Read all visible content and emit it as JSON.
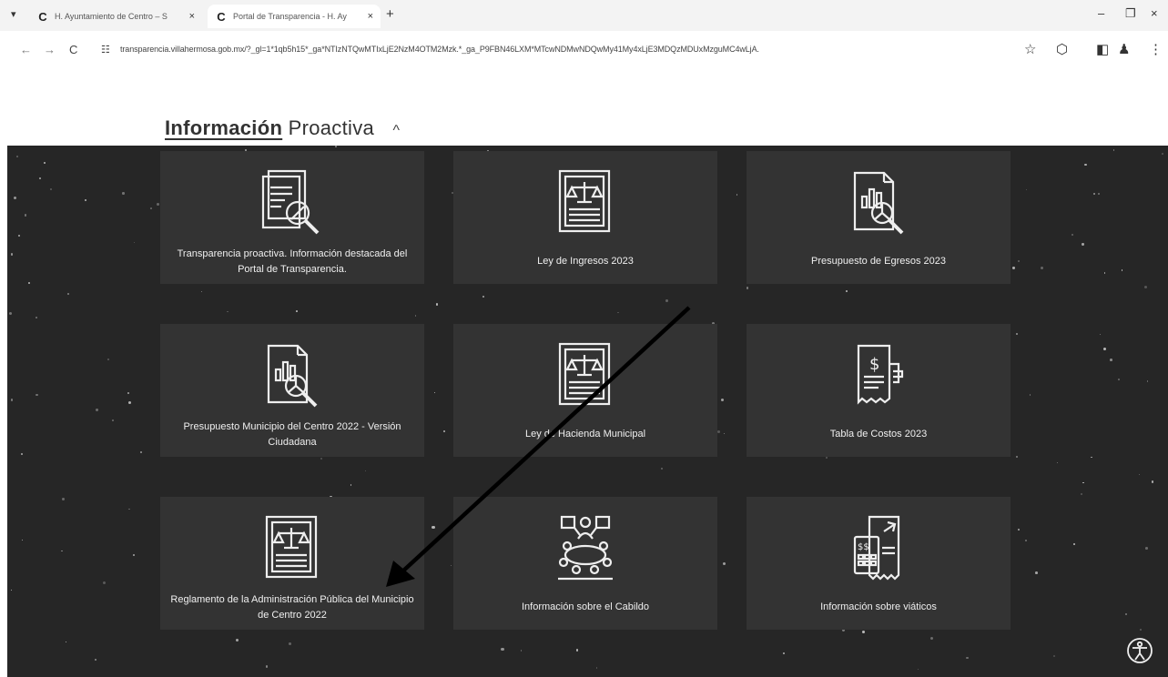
{
  "browser": {
    "tabs": [
      {
        "favicon": "C",
        "title": "H. Ayuntamiento de Centro – S",
        "close": "×"
      },
      {
        "favicon": "C",
        "title": "Portal de Transparencia - H. Ay",
        "close": "×"
      }
    ],
    "new_tab": "+",
    "url": "transparencia.villahermosa.gob.mx/?_gl=1*1qb5h15*_ga*NTIzNTQwMTIxLjE2NzM4OTM2Mzk.*_ga_P9FBN46LXM*MTcwNDMwNDQwMy41My4xLjE3MDQzMDUxMzguMC4wLjA."
  },
  "section": {
    "title_bold": "Información",
    "title_rest": "Proactiva",
    "chevron": "^"
  },
  "cards": [
    {
      "label": "Transparencia proactiva. Información destacada del Portal de Transparencia.",
      "icon": "document-search-icon"
    },
    {
      "label": "Ley de Ingresos 2023",
      "icon": "law-book-icon"
    },
    {
      "label": "Presupuesto de Egresos 2023",
      "icon": "budget-report-search-icon"
    },
    {
      "label": "Presupuesto Municipio del Centro 2022 - Versión Ciudadana",
      "icon": "budget-report-search-icon"
    },
    {
      "label": "Ley de Hacienda Municipal",
      "icon": "law-book-icon"
    },
    {
      "label": "Tabla de Costos 2023",
      "icon": "price-receipt-icon"
    },
    {
      "label": "Reglamento de la Administración Pública del Municipio de Centro 2022",
      "icon": "law-book-icon"
    },
    {
      "label": "Información sobre el Cabildo",
      "icon": "council-meeting-icon"
    },
    {
      "label": "Información sobre viáticos",
      "icon": "travel-expenses-icon"
    }
  ],
  "annotation": {
    "type": "arrow",
    "color": "#000000"
  },
  "colors": {
    "panel": "#262626",
    "card": "#333333",
    "card_text": "#f0f0f0"
  }
}
